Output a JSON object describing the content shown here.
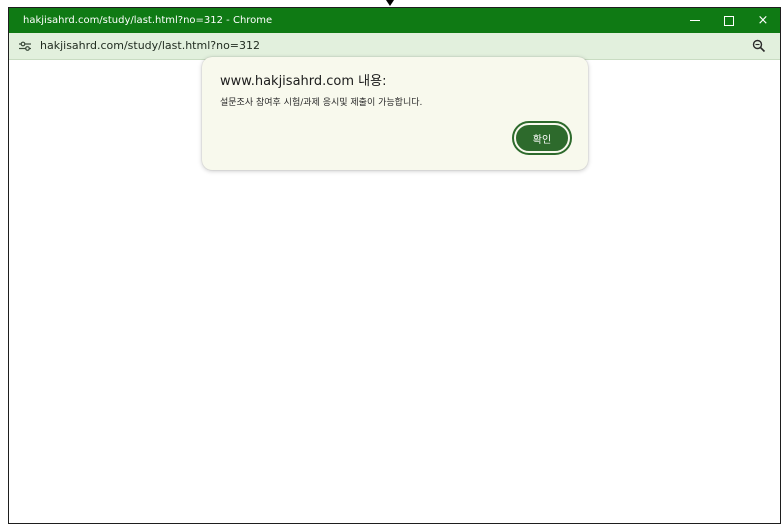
{
  "window": {
    "title": "hakjisahrd.com/study/last.html?no=312 - Chrome",
    "controls": {
      "minimize": "minimize",
      "maximize": "maximize",
      "close": "×"
    }
  },
  "addressbar": {
    "url": "hakjisahrd.com/study/last.html?no=312",
    "site_icon": "tune-icon",
    "zoom_icon": "zoom-icon"
  },
  "dialog": {
    "title": "www.hakjisahrd.com 내용:",
    "message": "설문조사 참여후 시험/과제 응시및 제출이 가능합니다.",
    "ok_label": "확인"
  },
  "colors": {
    "titlebar": "#0f7a14",
    "addressbar": "#e2f0dd",
    "dialog_bg": "#f8f9ed",
    "ok_button": "#2d6a2c"
  }
}
